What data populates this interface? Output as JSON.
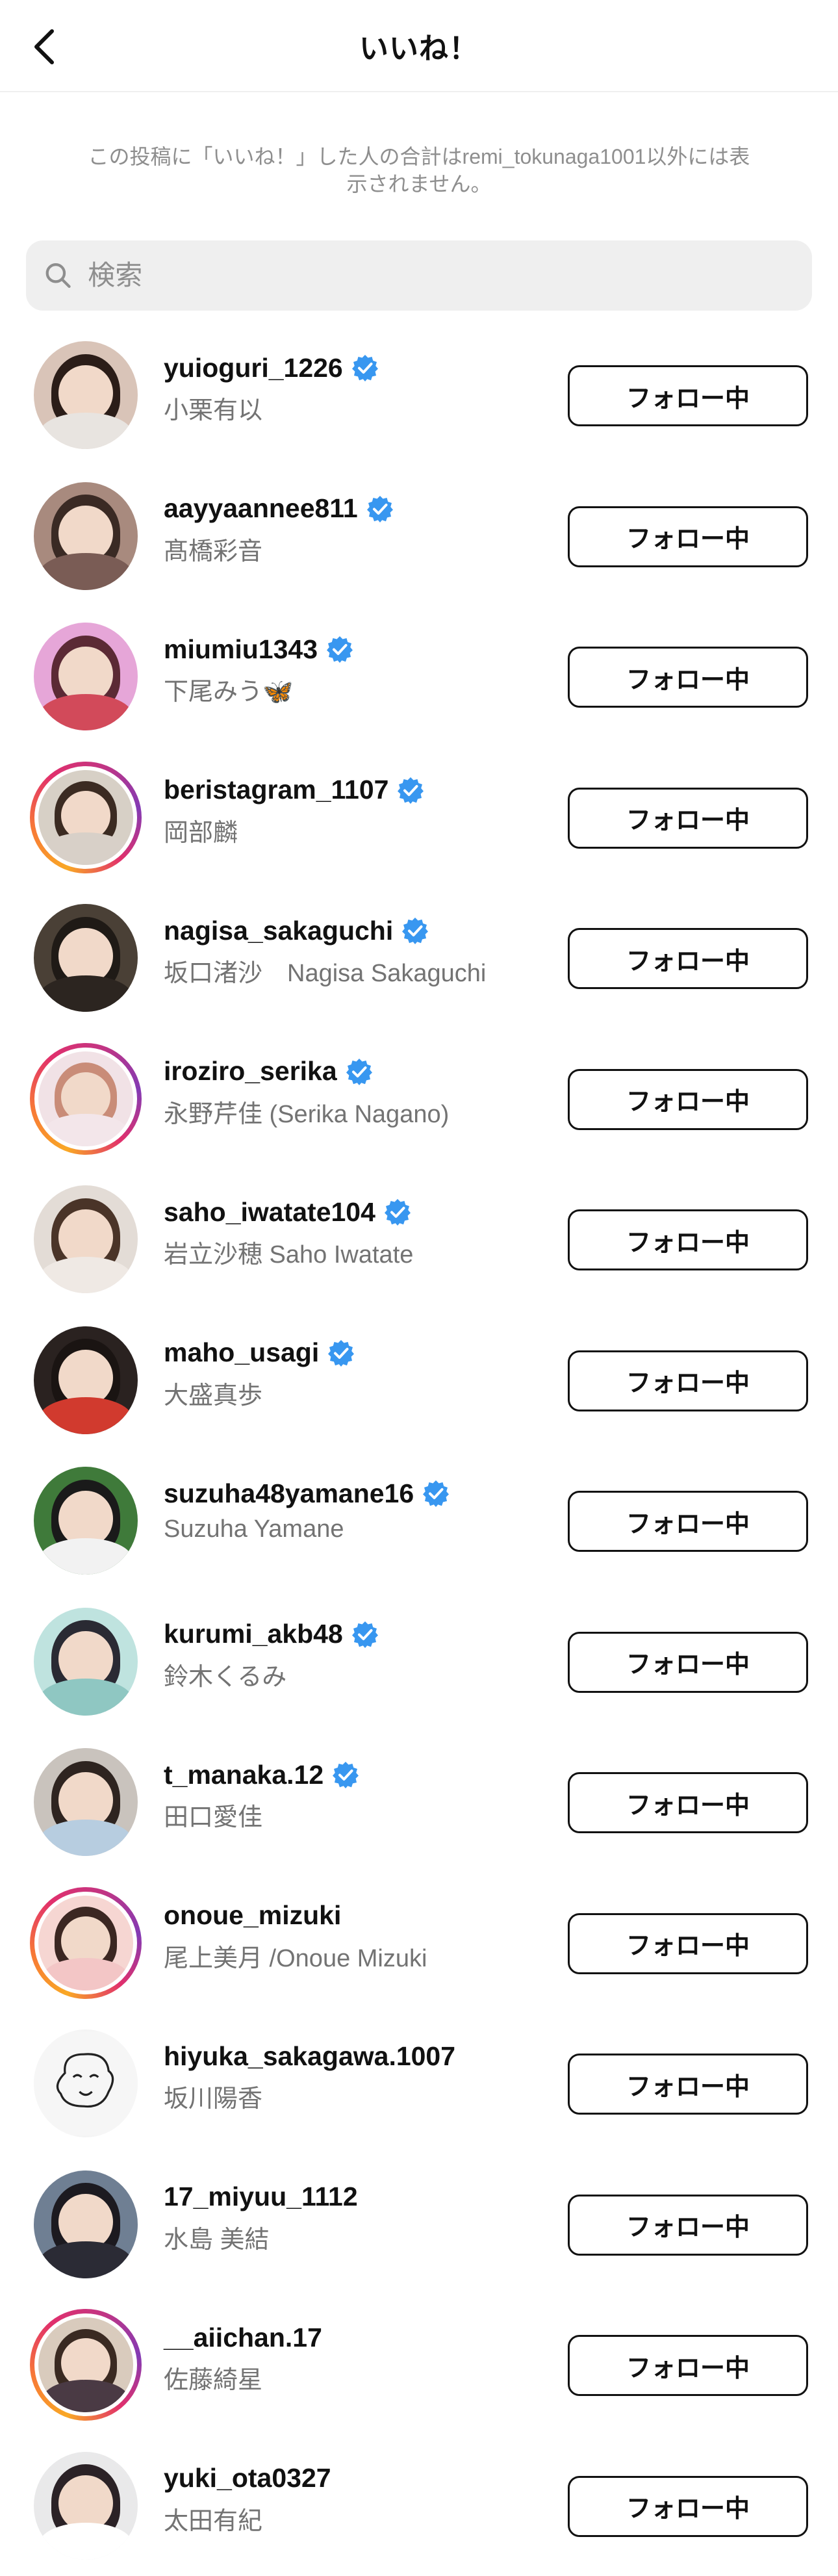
{
  "header": {
    "title": "いいね！",
    "back_icon": "chevron-left-icon"
  },
  "notice": "この投稿に「いいね！」した人の合計はremi_tokunaga1001以外には表示されません。",
  "search": {
    "placeholder": "検索",
    "icon": "search-icon"
  },
  "follow_label": "フォロー中",
  "colors": {
    "verified": "#3897f0",
    "secondary_text": "#737373",
    "search_bg": "#efefef"
  },
  "users": [
    {
      "username": "yuioguri_1226",
      "fullname": "小栗有以",
      "verified": true,
      "ring": false,
      "colors": [
        "#d9c4b8",
        "#2b1d18",
        "#e8e4e0"
      ]
    },
    {
      "username": "aayyaannee811",
      "fullname": "髙橋彩音",
      "verified": true,
      "ring": false,
      "colors": [
        "#a88a7e",
        "#3a2a24",
        "#7a5c55"
      ]
    },
    {
      "username": "miumiu1343",
      "fullname": "下尾みう🦋",
      "verified": true,
      "ring": false,
      "colors": [
        "#e6a6d8",
        "#5b2a35",
        "#d24a5a"
      ]
    },
    {
      "username": "beristagram_1107",
      "fullname": "岡部麟",
      "verified": true,
      "ring": true,
      "colors": [
        "#d7d0c6",
        "#3b2b22",
        "#d8d0c8"
      ]
    },
    {
      "username": "nagisa_sakaguchi",
      "fullname": "坂口渚沙　Nagisa Sakaguchi",
      "verified": true,
      "ring": false,
      "colors": [
        "#4a4036",
        "#1f1a16",
        "#2c2520"
      ]
    },
    {
      "username": "iroziro_serika",
      "fullname": "永野芹佳 (Serika Nagano)",
      "verified": true,
      "ring": true,
      "colors": [
        "#f1e2e6",
        "#c98c78",
        "#f3e6ea"
      ]
    },
    {
      "username": "saho_iwatate104",
      "fullname": "岩立沙穂  Saho Iwatate",
      "verified": true,
      "ring": false,
      "colors": [
        "#e3dcd6",
        "#4a3428",
        "#efe9e4"
      ]
    },
    {
      "username": "maho_usagi",
      "fullname": "大盛真歩",
      "verified": true,
      "ring": false,
      "colors": [
        "#2a2220",
        "#1a1412",
        "#d13a2e"
      ]
    },
    {
      "username": "suzuha48yamane16",
      "fullname": "Suzuha Yamane",
      "verified": true,
      "ring": false,
      "colors": [
        "#3f7a3a",
        "#1a1a1a",
        "#f2f2f2"
      ]
    },
    {
      "username": "kurumi_akb48",
      "fullname": "鈴木くるみ",
      "verified": true,
      "ring": false,
      "colors": [
        "#bfe3df",
        "#2a2a33",
        "#8fc7c2"
      ]
    },
    {
      "username": "t_manaka.12",
      "fullname": "田口愛佳",
      "verified": true,
      "ring": false,
      "colors": [
        "#c9c3bd",
        "#2e2420",
        "#b7cde0"
      ]
    },
    {
      "username": "onoue_mizuki",
      "fullname": "尾上美月 /Onoue Mizuki",
      "verified": false,
      "ring": true,
      "colors": [
        "#f6d6d2",
        "#3b2722",
        "#f3c6c6"
      ]
    },
    {
      "username": "hiyuka_sakagawa.1007",
      "fullname": "坂川陽香",
      "verified": false,
      "ring": false,
      "colors": [
        "#f4f4f4",
        "#ffffff",
        "#f4f4f4"
      ],
      "drawing": true
    },
    {
      "username": "17_miyuu_1112",
      "fullname": "水島 美結",
      "verified": false,
      "ring": false,
      "colors": [
        "#6f7f93",
        "#1c1a20",
        "#2b2b35"
      ]
    },
    {
      "username": "__aiichan.17",
      "fullname": "佐藤綺星",
      "verified": false,
      "ring": true,
      "colors": [
        "#d9cbbd",
        "#3a2a22",
        "#4a3a44"
      ]
    },
    {
      "username": "yuki_ota0327",
      "fullname": "太田有紀",
      "verified": false,
      "ring": false,
      "colors": [
        "#e9e9ea",
        "#2b2226",
        "#ffffff"
      ]
    }
  ]
}
